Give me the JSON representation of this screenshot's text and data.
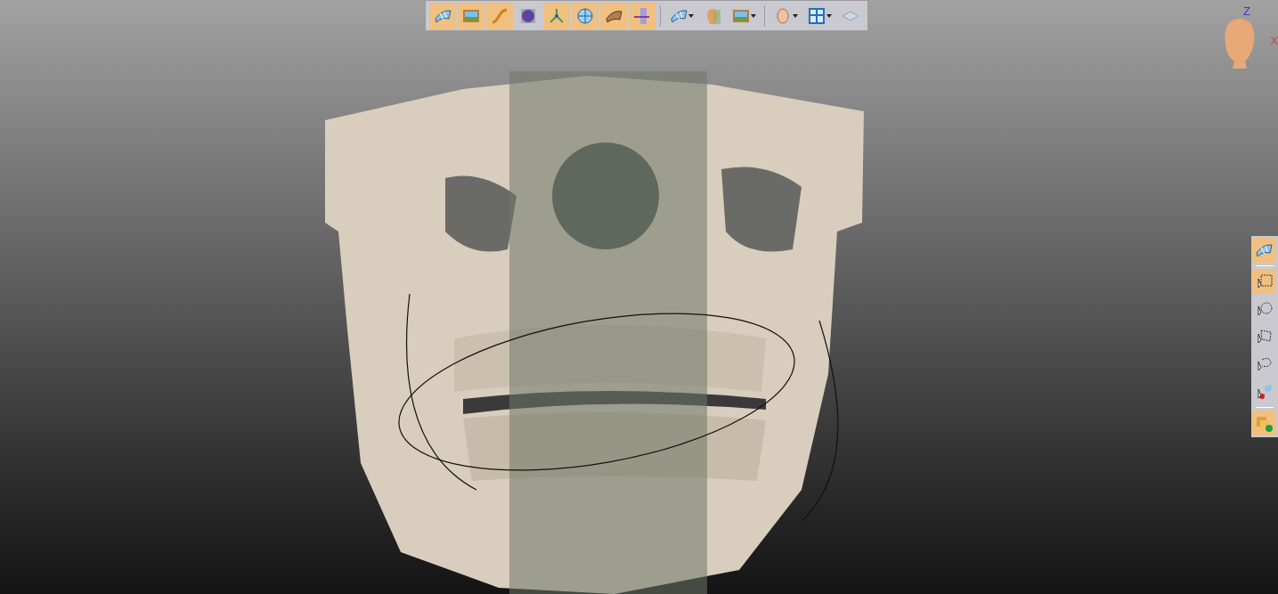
{
  "toolbar": {
    "buttons": [
      {
        "kind": "surface",
        "selected": true,
        "dropdown": false
      },
      {
        "kind": "image",
        "selected": true,
        "dropdown": false
      },
      {
        "kind": "curve",
        "selected": true,
        "dropdown": false
      },
      {
        "kind": "sphere",
        "selected": false,
        "dropdown": false
      },
      {
        "kind": "axes",
        "selected": true,
        "dropdown": false
      },
      {
        "kind": "globe",
        "selected": true,
        "dropdown": false
      },
      {
        "kind": "mesh",
        "selected": true,
        "dropdown": false
      },
      {
        "kind": "plane",
        "selected": true,
        "dropdown": false
      },
      {
        "kind": "surface",
        "selected": false,
        "dropdown": true
      },
      {
        "kind": "head",
        "selected": false,
        "dropdown": false
      },
      {
        "kind": "image",
        "selected": false,
        "dropdown": true
      },
      {
        "kind": "face",
        "selected": false,
        "dropdown": true
      },
      {
        "kind": "layout",
        "selected": false,
        "dropdown": true
      },
      {
        "kind": "layer",
        "selected": false,
        "dropdown": false
      }
    ]
  },
  "orientation": {
    "up_axis": "Z",
    "side_axis": "X"
  },
  "side_toolbar": {
    "tools": [
      {
        "kind": "surface",
        "selected": true
      },
      {
        "kind": "rect-select",
        "selected": true
      },
      {
        "kind": "circle-select",
        "selected": false
      },
      {
        "kind": "poly-select",
        "selected": false
      },
      {
        "kind": "lasso-select",
        "selected": false
      },
      {
        "kind": "paint-select",
        "selected": false
      },
      {
        "kind": "add-layer",
        "selected": true
      }
    ]
  }
}
